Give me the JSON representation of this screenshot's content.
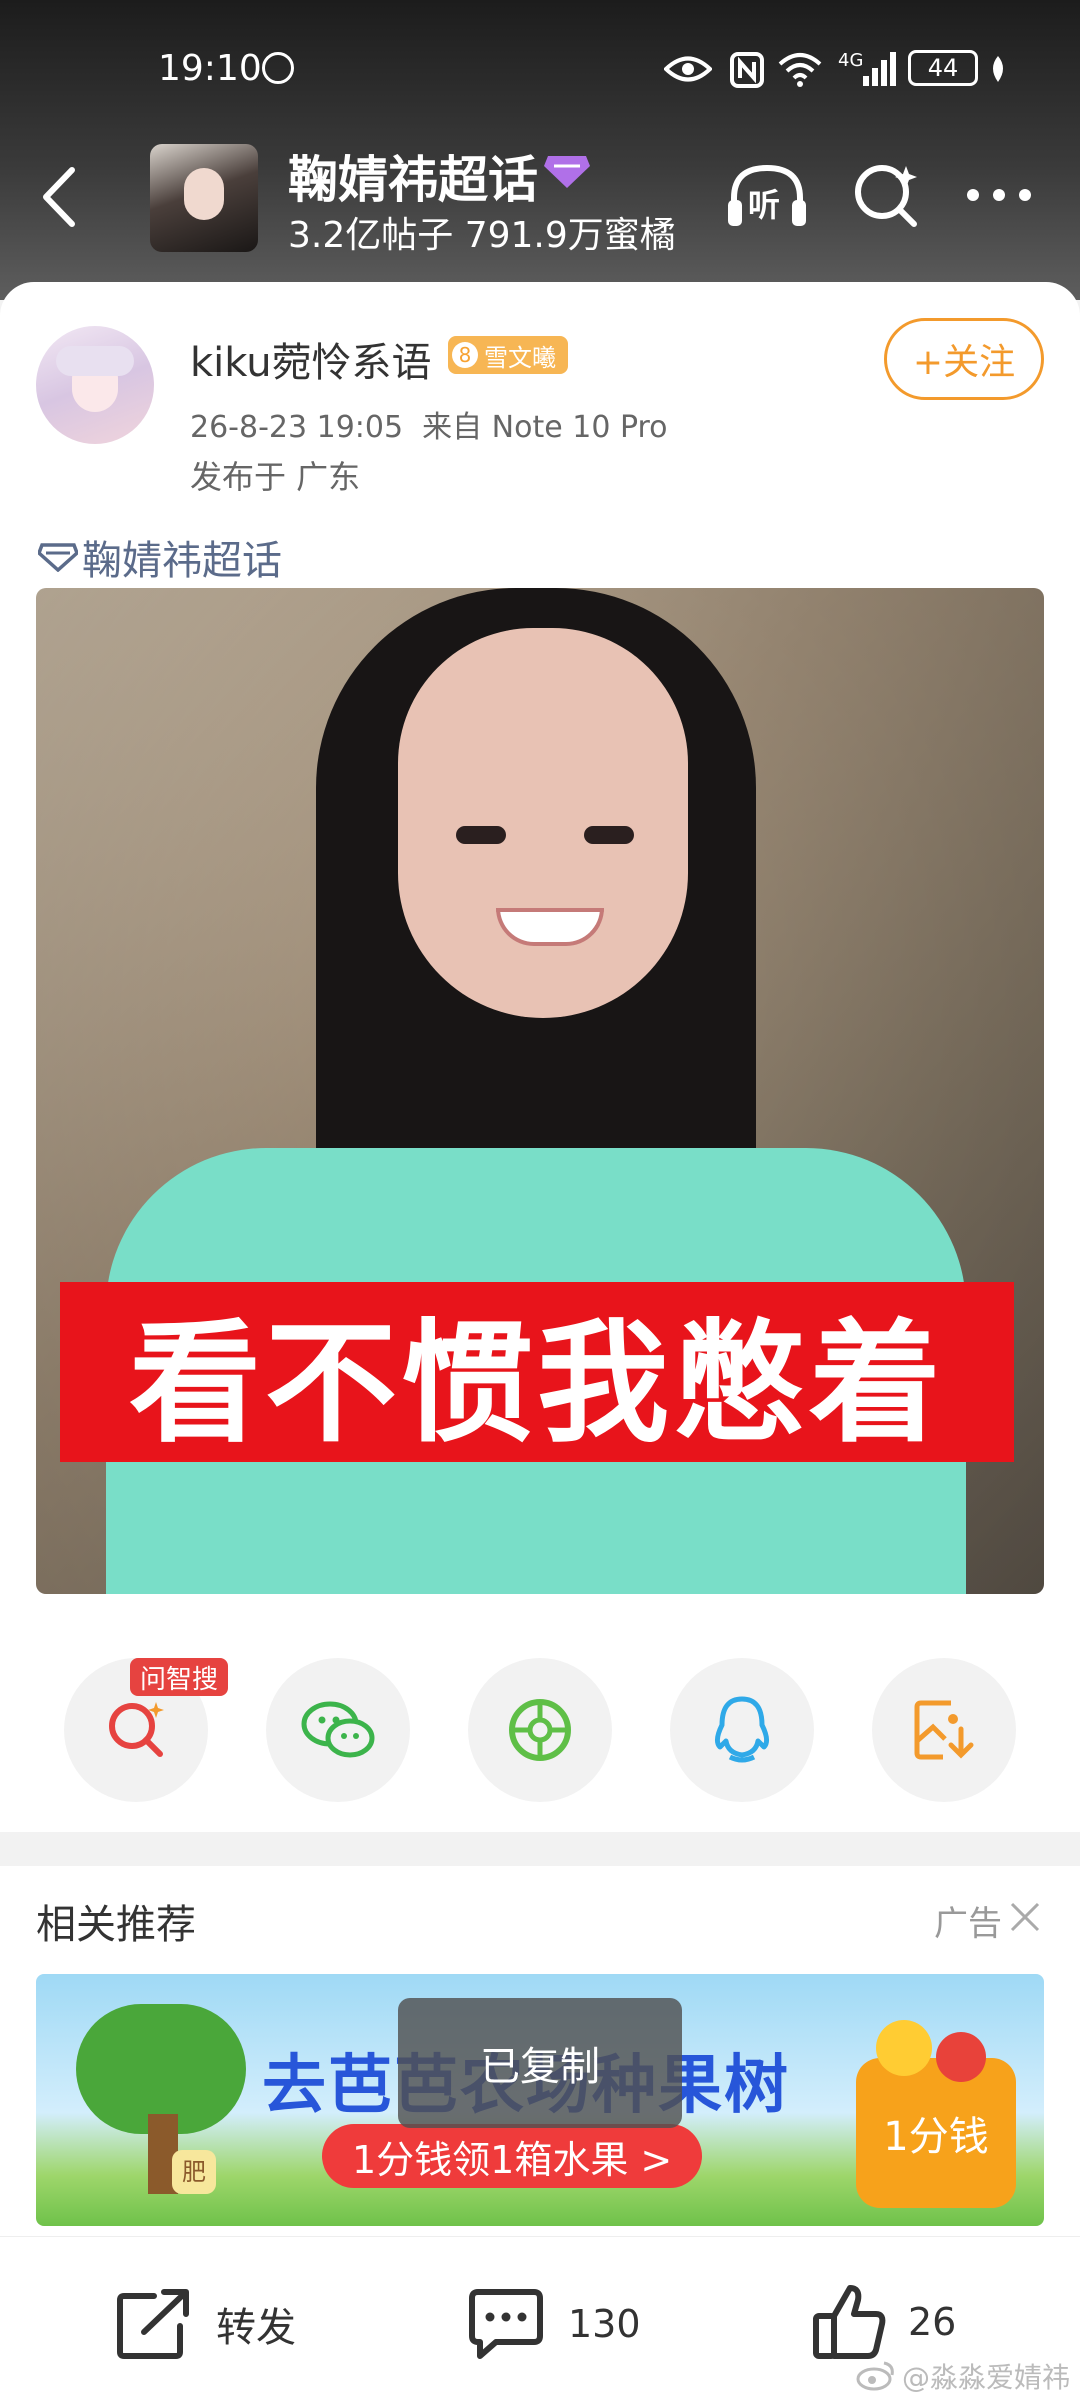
{
  "status_bar": {
    "time": "19:10",
    "network": "4G",
    "battery": "44"
  },
  "header": {
    "title": "鞠婧祎超话",
    "stats": "3.2亿帖子 791.9万蜜橘",
    "listen_label": "听"
  },
  "post": {
    "username": "kiku菀怜系语",
    "badge_level": "8",
    "badge_text": "雪文曦",
    "meta": "26-8-23 19:05  来自 Note 10 Pro",
    "location": "发布于 广东",
    "follow_label": "+关注",
    "topic": "鞠婧祎超话",
    "image_caption": "看不惯我憋着"
  },
  "share": {
    "badge": "问智搜"
  },
  "related": {
    "title": "相关推荐",
    "ad_label": "广告",
    "banner_title": "去芭芭农场种果树",
    "banner_cta": "1分钱领1箱水果 >",
    "banner_price": "1分钱",
    "toast": "已复制",
    "fertilizer": "肥"
  },
  "bottom_bar": {
    "repost_label": "转发",
    "comment_count": "130",
    "like_count": "26"
  },
  "watermark": "@淼淼爱婧祎",
  "colors": {
    "accent_orange": "#f39a2c",
    "link_blue": "#5b6b8a",
    "badge_red": "#e64340"
  }
}
